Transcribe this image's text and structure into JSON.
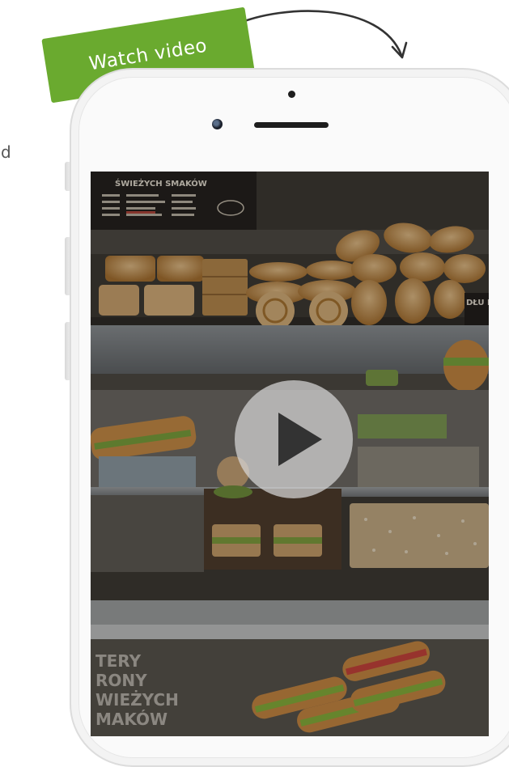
{
  "page": {
    "side_text": "d",
    "background_color": "#ffffff"
  },
  "cta": {
    "label": "Watch video",
    "color": "#6aaa2f",
    "arrow_icon": "curved-arrow-icon"
  },
  "phone": {
    "frame_color": "#fafafa",
    "video": {
      "play_icon": "play-icon",
      "menu_board_heading": "ŚWIEŻYCH SMAKÓW",
      "side_sign_text": "DŁU DRI",
      "poster_lines": [
        "TERY",
        "RONY",
        "WIEŻYCH",
        "MAKÓW"
      ]
    }
  }
}
